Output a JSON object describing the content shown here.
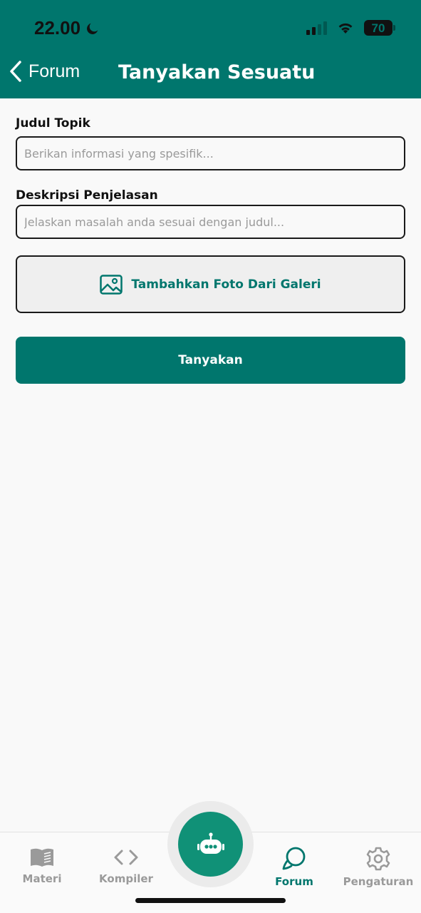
{
  "status_bar": {
    "time": "22.00",
    "battery": "70"
  },
  "header": {
    "back_label": "Forum",
    "title": "Tanyakan Sesuatu"
  },
  "form": {
    "topic_label": "Judul Topik",
    "topic_placeholder": "Berikan informasi yang spesifik...",
    "topic_value": "",
    "description_label": "Deskripsi Penjelasan",
    "description_placeholder": "Jelaskan masalah anda sesuai dengan judul...",
    "description_value": "",
    "photo_button_label": "Tambahkan Foto Dari Galeri",
    "submit_label": "Tanyakan"
  },
  "nav": {
    "items": [
      {
        "label": "Materi",
        "icon": "book-icon"
      },
      {
        "label": "Kompiler",
        "icon": "code-icon"
      },
      {
        "label": "Forum",
        "icon": "chat-bubbles-icon",
        "active": true
      },
      {
        "label": "Pengaturan",
        "icon": "gear-icon"
      }
    ],
    "fab_icon": "robot-icon"
  },
  "colors": {
    "primary": "#00766d",
    "fab": "#109177",
    "inactive": "#9a9a9a",
    "background": "#f9f9f9"
  }
}
